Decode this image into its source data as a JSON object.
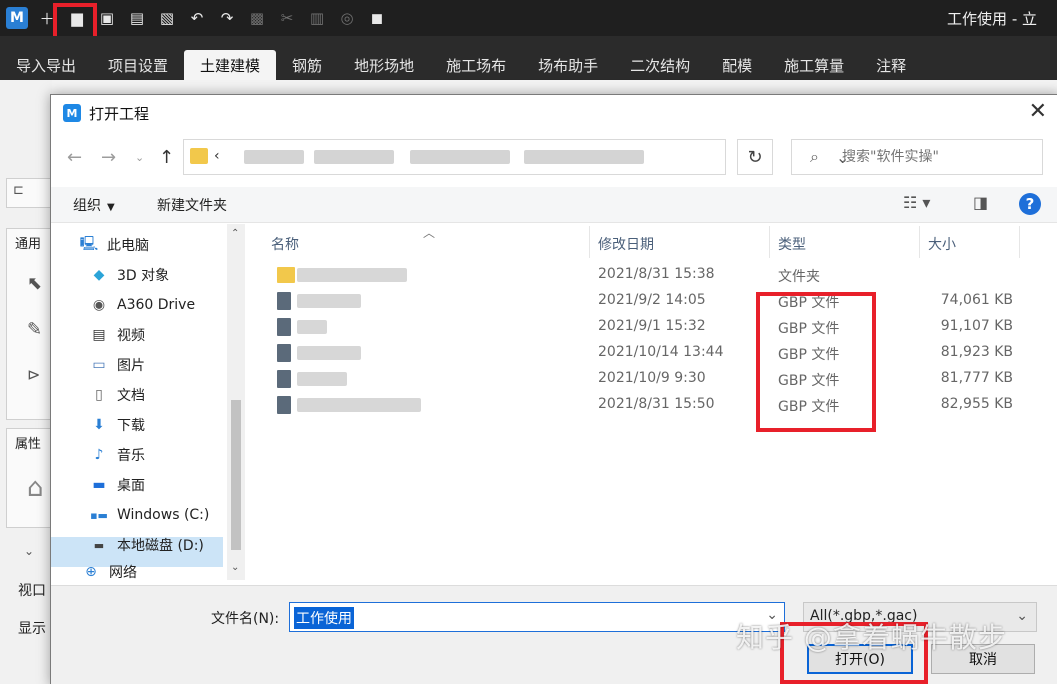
{
  "app": {
    "logo": "M",
    "title": "工作使用 - 立"
  },
  "toolbar_icons": [
    "new-icon",
    "open-folder-icon",
    "save-icon",
    "save-as-icon",
    "close-file-icon",
    "undo-icon",
    "redo-icon",
    "select-icon",
    "cut-icon",
    "paste-icon",
    "layer-icon",
    "cube-icon"
  ],
  "ribbon": {
    "tabs": [
      "导入导出",
      "项目设置",
      "土建建模",
      "钢筋",
      "地形场地",
      "施工场布",
      "场布助手",
      "二次结构",
      "配模",
      "施工算量",
      "注释"
    ],
    "active_index": 2
  },
  "left_panel": {
    "general_label": "通用",
    "properties_label": "属性",
    "viewport_label": "视口",
    "display_label": "显示"
  },
  "dialog": {
    "title": "打开工程",
    "address_prefix": "‹",
    "search_placeholder": "搜索\"软件实操\"",
    "organize_label": "组织",
    "new_folder_label": "新建文件夹",
    "tree": [
      {
        "label": "此电脑",
        "icon": "computer-icon"
      },
      {
        "label": "3D 对象",
        "icon": "3d-objects-icon"
      },
      {
        "label": "A360 Drive",
        "icon": "a360-drive-icon"
      },
      {
        "label": "视频",
        "icon": "video-icon"
      },
      {
        "label": "图片",
        "icon": "pictures-icon"
      },
      {
        "label": "文档",
        "icon": "documents-icon"
      },
      {
        "label": "下载",
        "icon": "download-icon"
      },
      {
        "label": "音乐",
        "icon": "music-icon"
      },
      {
        "label": "桌面",
        "icon": "desktop-icon"
      },
      {
        "label": "Windows (C:)",
        "icon": "windows-drive-icon"
      },
      {
        "label": "本地磁盘 (D:)",
        "icon": "local-disk-icon"
      },
      {
        "label": "网络",
        "icon": "network-icon"
      }
    ],
    "columns": {
      "name": "名称",
      "date": "修改日期",
      "type": "类型",
      "size": "大小"
    },
    "files": [
      {
        "date": "2021/8/31 15:38",
        "type": "文件夹",
        "size": "",
        "is_folder": true
      },
      {
        "date": "2021/9/2 14:05",
        "type": "GBP 文件",
        "size": "74,061 KB",
        "is_folder": false
      },
      {
        "date": "2021/9/1 15:32",
        "type": "GBP 文件",
        "size": "91,107 KB",
        "is_folder": false
      },
      {
        "date": "2021/10/14 13:44",
        "type": "GBP 文件",
        "size": "81,923 KB",
        "is_folder": false
      },
      {
        "date": "2021/10/9 9:30",
        "type": "GBP 文件",
        "size": "81,777 KB",
        "is_folder": false
      },
      {
        "date": "2021/8/31 15:50",
        "type": "GBP 文件",
        "size": "82,955 KB",
        "is_folder": false
      }
    ],
    "filename_label": "文件名(N):",
    "filename_value": "工作使用",
    "filter_value": "All(*.gbp,*.gac)",
    "open_button": "打开(O)",
    "cancel_button": "取消"
  },
  "watermark": "知乎 @拿着蜗牛散步",
  "colors": {
    "highlight": "#e8202a",
    "accent": "#0a64d6"
  }
}
